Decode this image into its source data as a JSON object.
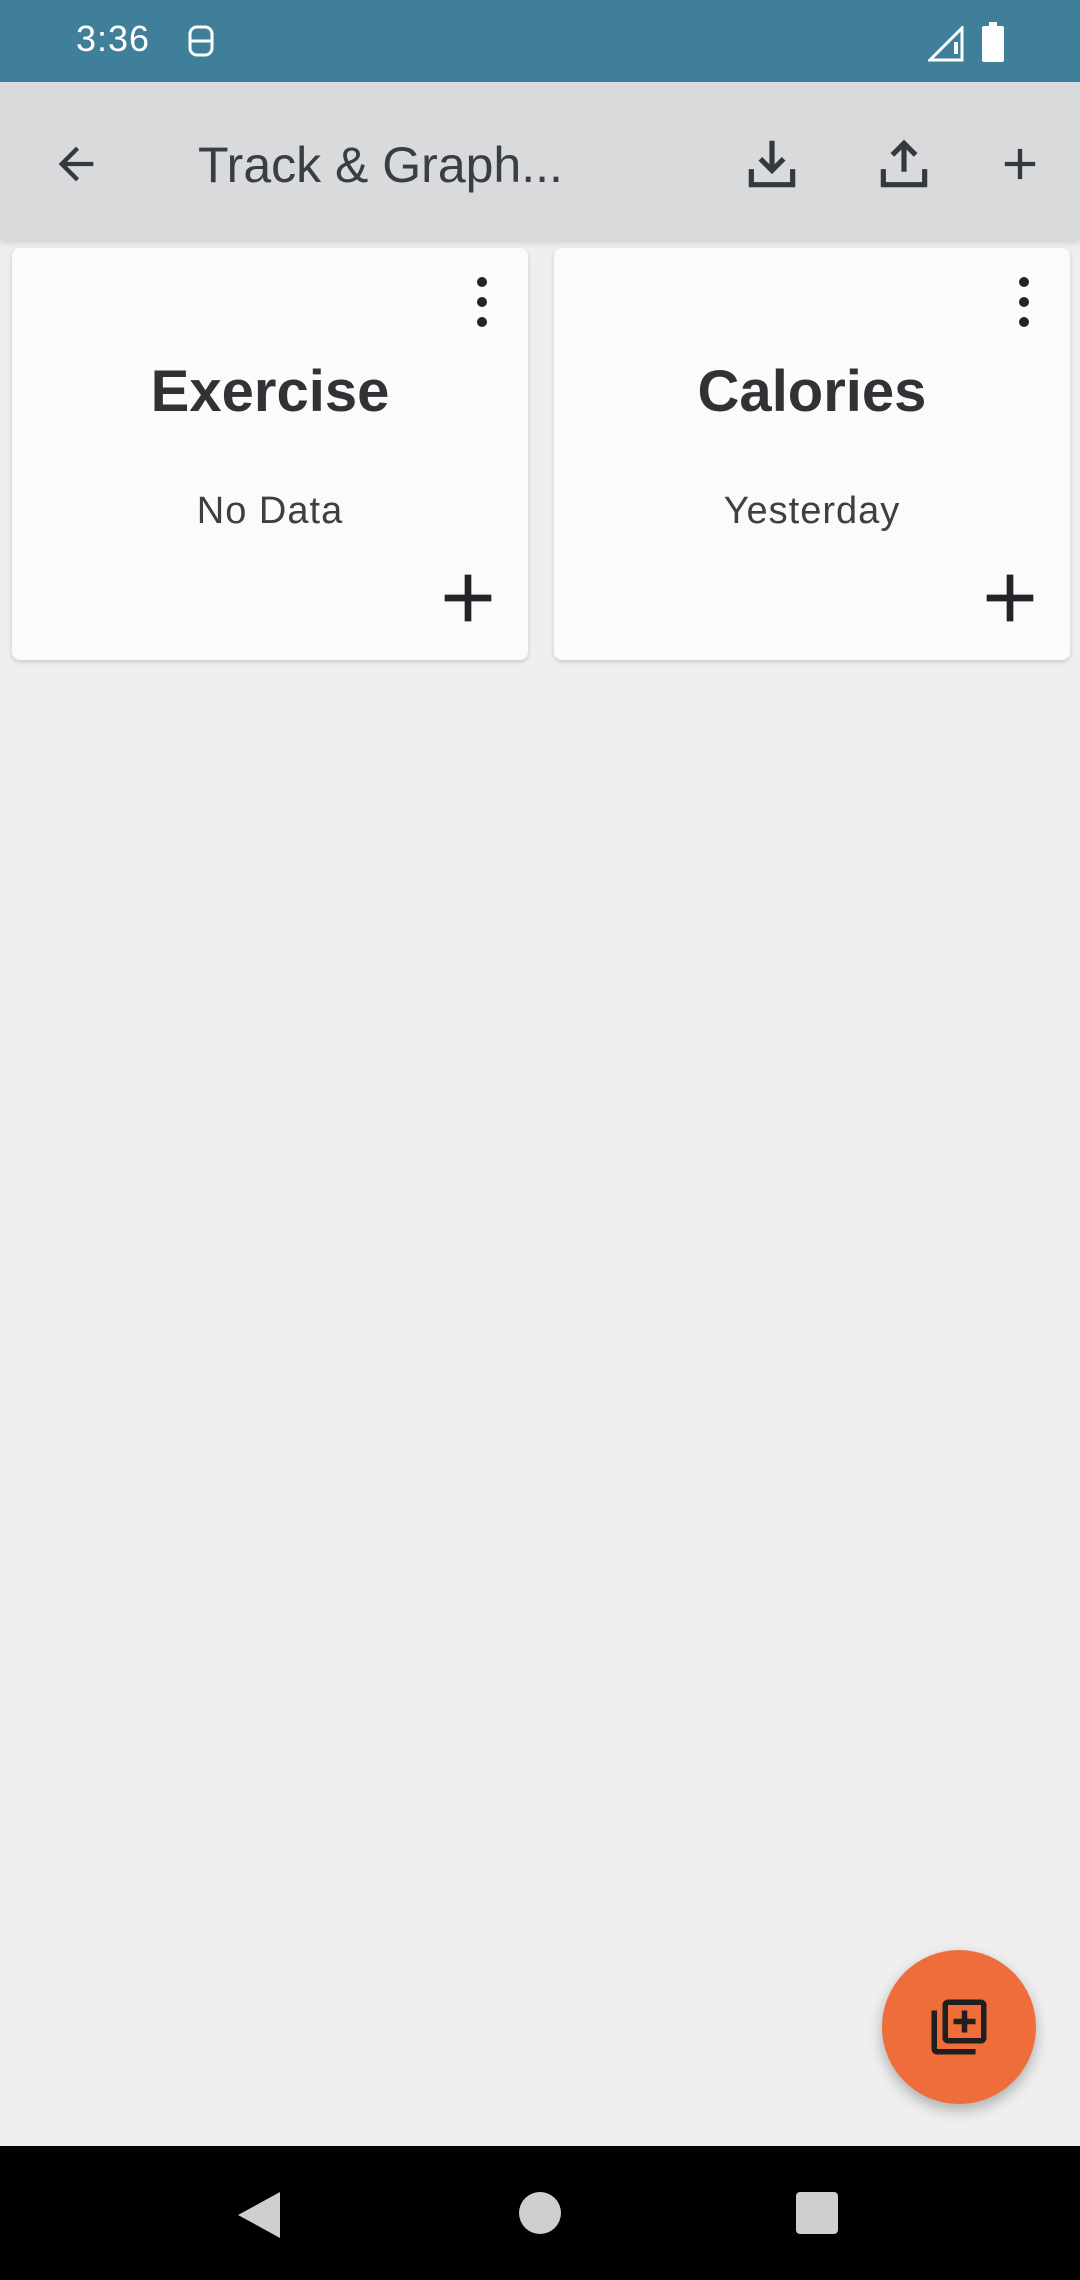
{
  "status_bar": {
    "time": "3:36",
    "app_icon": "keyboard-icon",
    "signal_icon": "signal-icon",
    "battery_icon": "battery-icon"
  },
  "app_bar": {
    "title": "Track & Graph...",
    "back_icon": "arrow-back-icon",
    "actions": [
      "download-icon",
      "upload-icon",
      "add-icon"
    ]
  },
  "cards": [
    {
      "title": "Exercise",
      "subtitle": "No Data"
    },
    {
      "title": "Calories",
      "subtitle": "Yesterday"
    }
  ],
  "fab": {
    "icon": "add-to-library-icon"
  },
  "nav_bar": {
    "icons": [
      "nav-back-icon",
      "nav-home-icon",
      "nav-recents-icon"
    ]
  },
  "colors": {
    "status_bar": "#3f7f99",
    "app_bar": "#d8dadc",
    "background": "#efefef",
    "card": "#fbfbfc",
    "fab": "#ee6d3b",
    "nav_bar": "#000000"
  }
}
